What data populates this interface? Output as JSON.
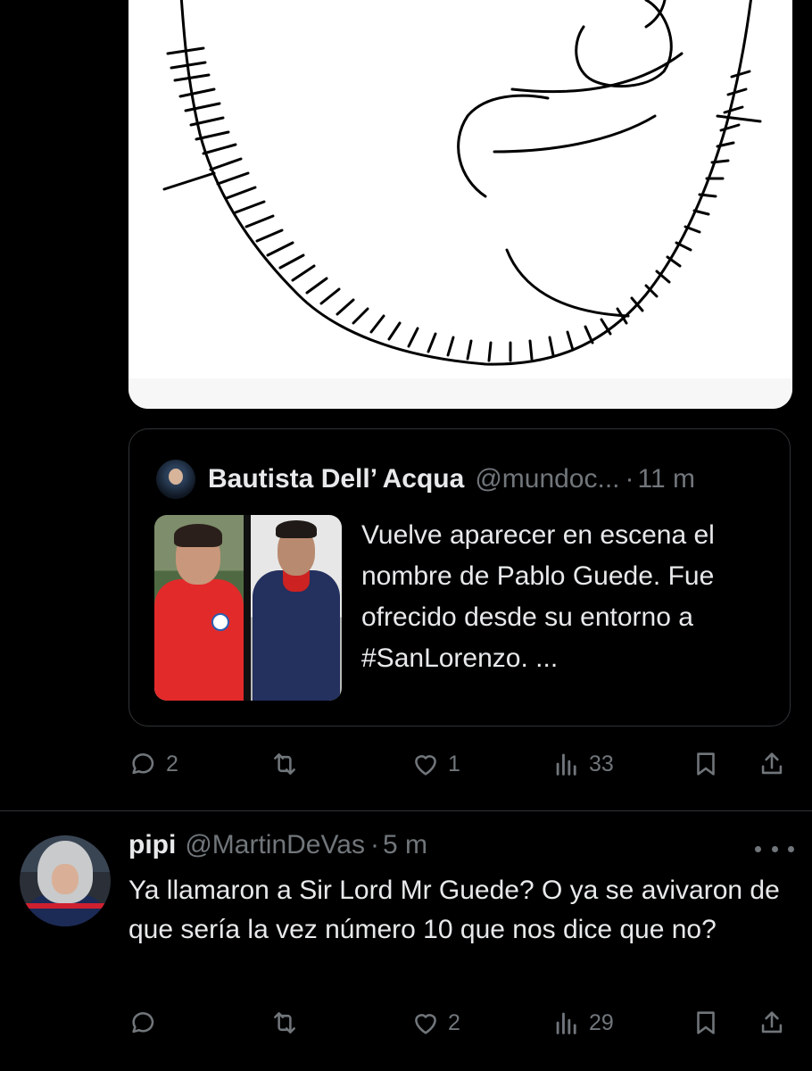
{
  "quote_tweet": {
    "author_name": "Bautista Dell’ Acqua",
    "author_handle": "@mundoc...",
    "separator": "·",
    "time": "11 m",
    "text": "Vuelve aparecer en escena el nombre de Pablo Guede. Fue ofrecido desde su entorno a #SanLorenzo. ..."
  },
  "main_actions": {
    "replies": "2",
    "reposts": "",
    "likes": "1",
    "views": "33"
  },
  "reply_tweet": {
    "author_name": "pipi",
    "author_handle": "@MartinDeVas",
    "separator": "·",
    "time": "5 m",
    "text": "Ya llamaron a Sir Lord Mr Guede? O ya se avivaron de que sería la vez número 10 que nos dice que no?"
  },
  "reply_actions": {
    "replies": "",
    "reposts": "",
    "likes": "2",
    "views": "29"
  },
  "icons": {
    "reply": "reply-icon",
    "repost": "repost-icon",
    "like": "heart-icon",
    "views": "views-icon",
    "bookmark": "bookmark-icon",
    "share": "share-icon",
    "more": "more-icon"
  },
  "colors": {
    "background": "#000000",
    "text_primary": "#e7e9ea",
    "text_secondary": "#71767b",
    "border": "#2f3336"
  }
}
